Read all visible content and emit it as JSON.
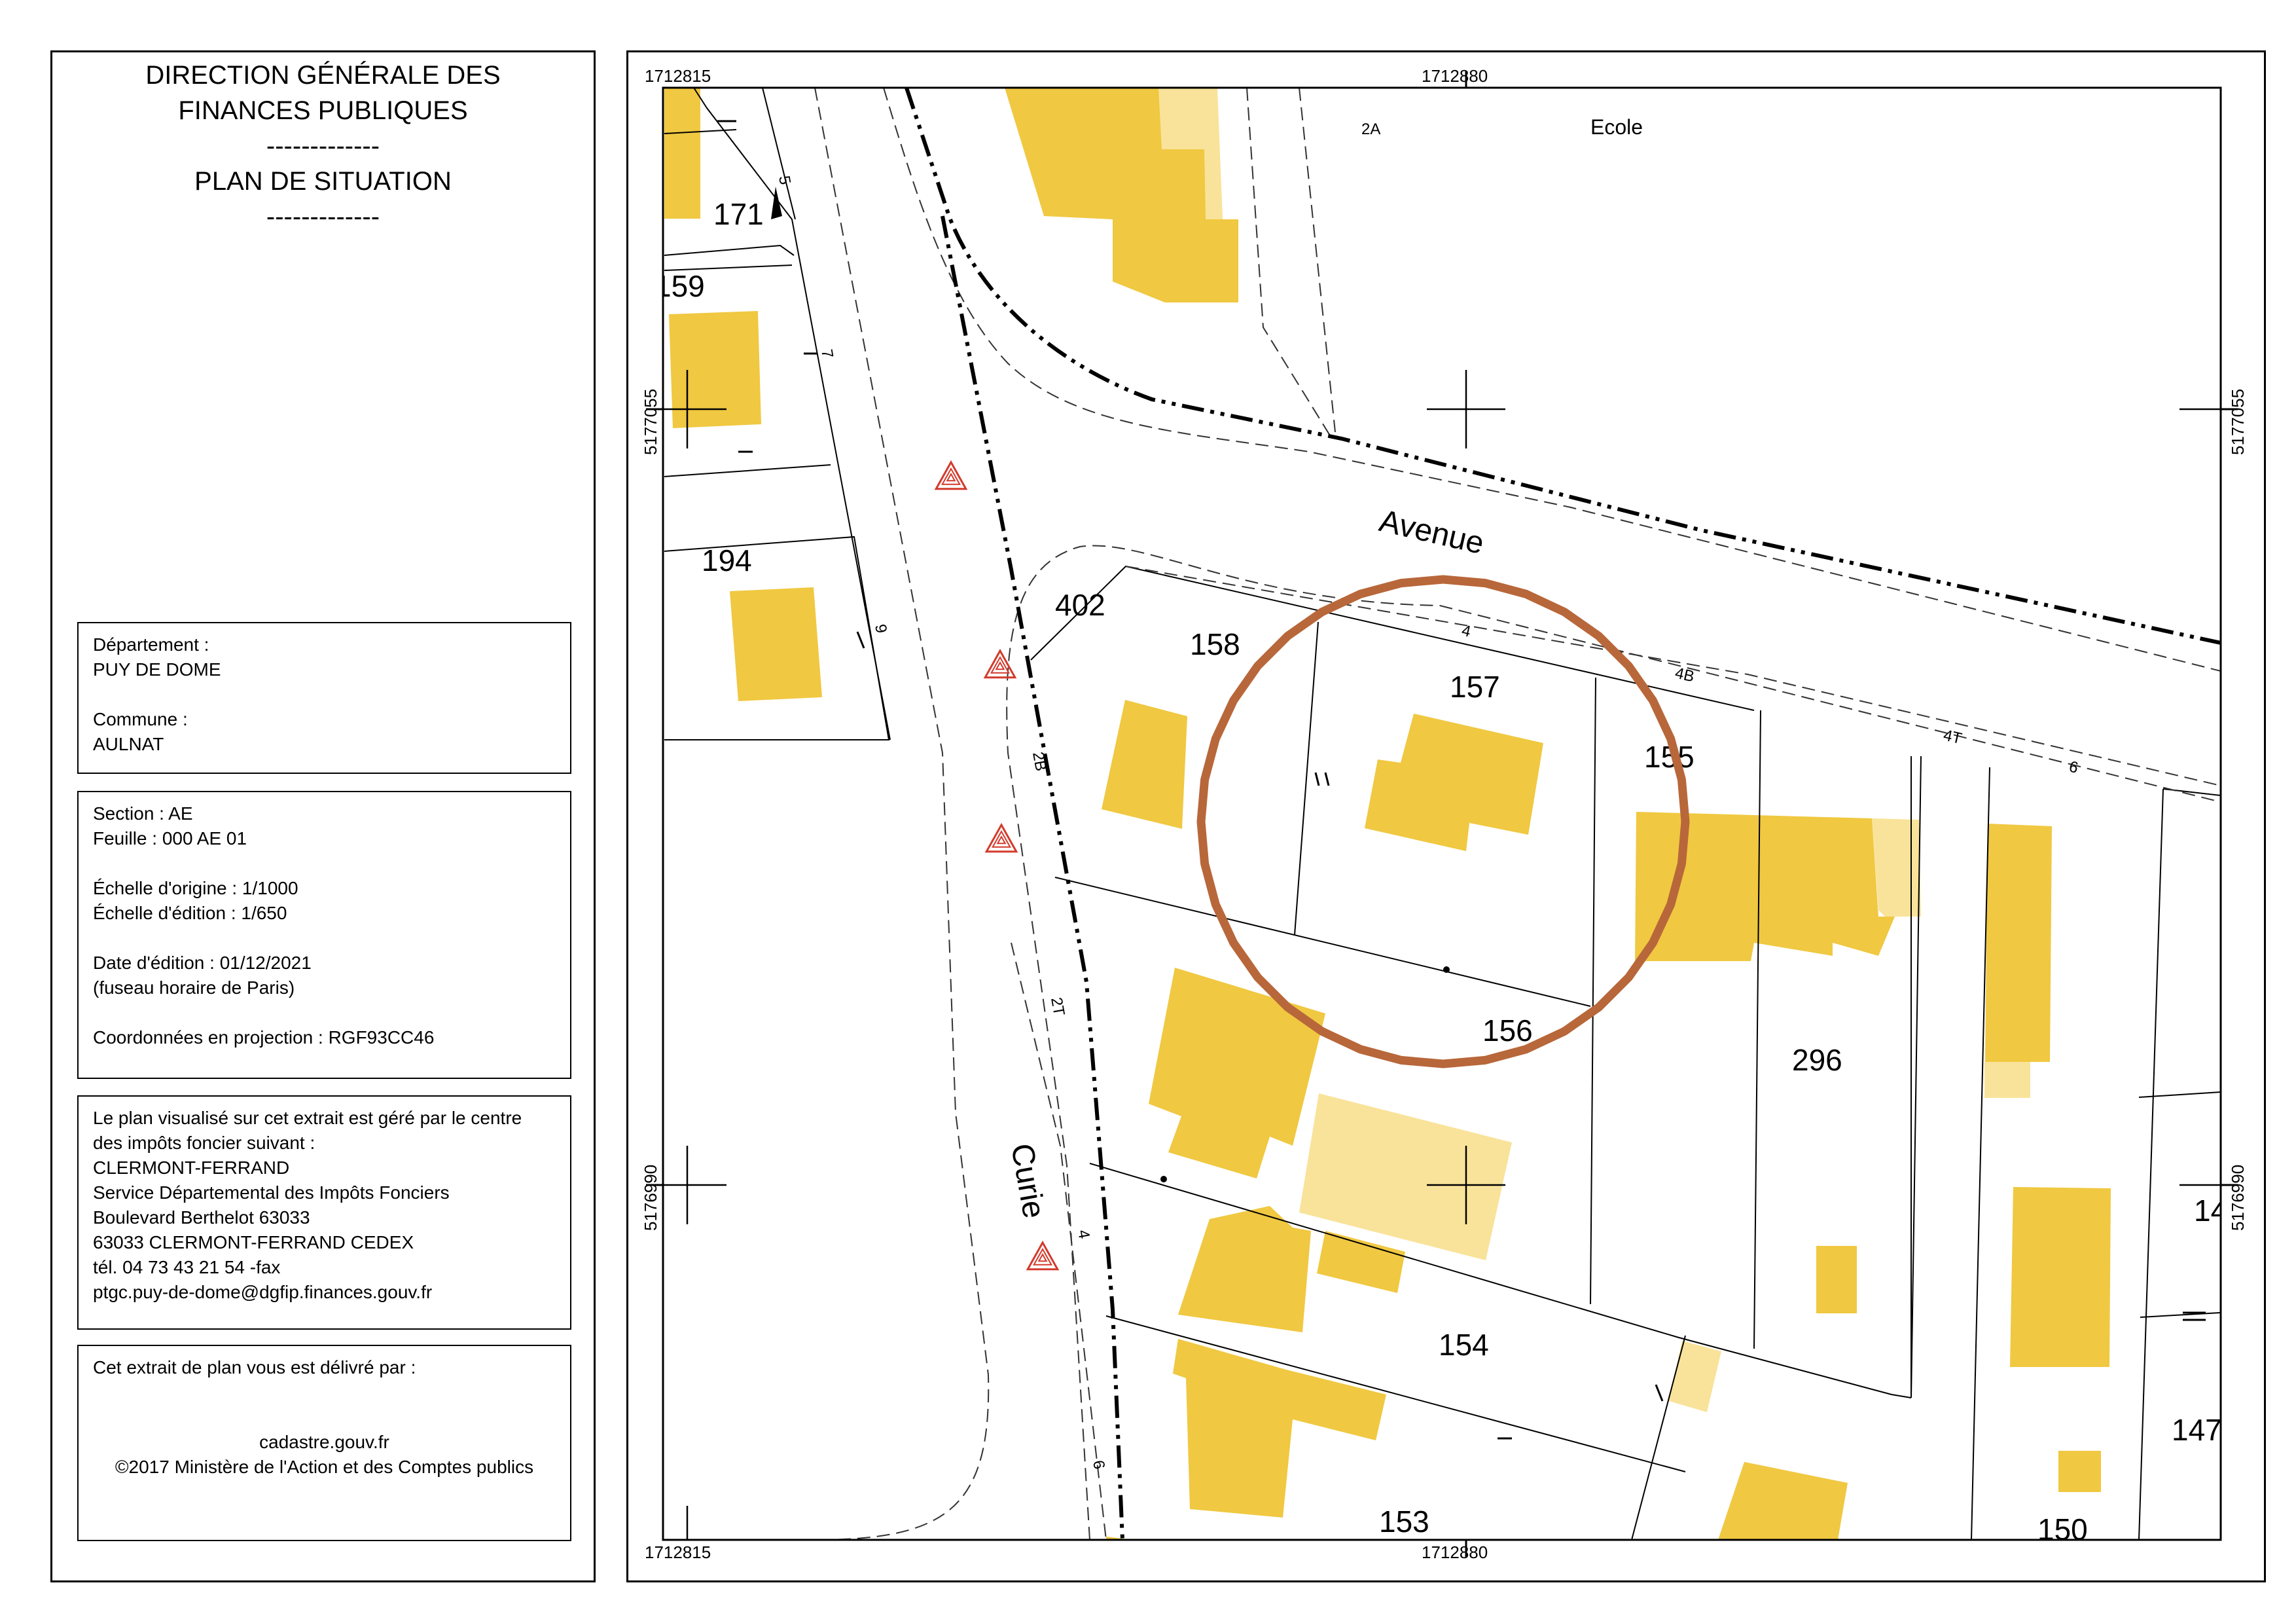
{
  "header": {
    "line1": "DIRECTION GÉNÉRALE DES",
    "line2": "FINANCES PUBLIQUES",
    "sep1": "-------------",
    "line3": "PLAN DE SITUATION",
    "sep2": "-------------"
  },
  "box_commune": {
    "departement_label": "Département :",
    "departement": "PUY DE DOME",
    "commune_label": "Commune :",
    "commune": "AULNAT"
  },
  "box_section": {
    "section": "Section : AE",
    "feuille": "Feuille : 000 AE 01",
    "echelle_origine": "Échelle d'origine : 1/1000",
    "echelle_edition": "Échelle d'édition : 1/650",
    "date_edition": "Date d'édition : 01/12/2021",
    "fuseau": "(fuseau horaire de Paris)",
    "projection": "Coordonnées en projection : RGF93CC46"
  },
  "box_centre": {
    "l1": "Le plan visualisé sur cet extrait est géré par le centre",
    "l2": "des impôts foncier suivant :",
    "l3": "CLERMONT-FERRAND",
    "l4": "Service Départemental des Impôts Fonciers",
    "l5": "Boulevard Berthelot 63033",
    "l6": "63033 CLERMONT-FERRAND CEDEX",
    "l7": "tél. 04 73 43 21 54 -fax",
    "l8": "ptgc.puy-de-dome@dgfip.finances.gouv.fr"
  },
  "box_delivery": {
    "l1": "Cet extrait de plan vous est délivré par :",
    "l2": "cadastre.gouv.fr",
    "l3": "©2017 Ministère de l'Action et des Comptes publics"
  },
  "map": {
    "coords": {
      "x_left_top": "1712815",
      "x_mid_top": "1712880",
      "x_left_bottom": "1712815",
      "x_mid_bottom": "1712880",
      "y_upper_left": "5177055",
      "y_upper_right": "5177055",
      "y_lower_left": "5176990",
      "y_lower_right": "5176990"
    },
    "streets": {
      "avenue": "Avenue",
      "curie": "Curie",
      "ecole": "Ecole"
    },
    "parcels": {
      "p171": "171",
      "p159": "159",
      "p194": "194",
      "p402": "402",
      "p158": "158",
      "p157": "157",
      "p155": "155",
      "p156": "156",
      "p296": "296",
      "p154": "154",
      "p153": "153",
      "p150": "150",
      "p14": "14",
      "p147": "147"
    },
    "house_numbers": {
      "n2A": "2A",
      "n5": "5",
      "n7": "7",
      "n9": "9",
      "n2B": "2B",
      "n2T": "2T",
      "n4c": "4",
      "n6c": "6",
      "n4": "4",
      "n4B": "4B",
      "n4T": "4T",
      "n6": "6"
    },
    "colors": {
      "building": "#f0c841",
      "building_light": "#f9e39a",
      "selection_circle": "#b8673a",
      "marker": "#d33a2c"
    }
  }
}
